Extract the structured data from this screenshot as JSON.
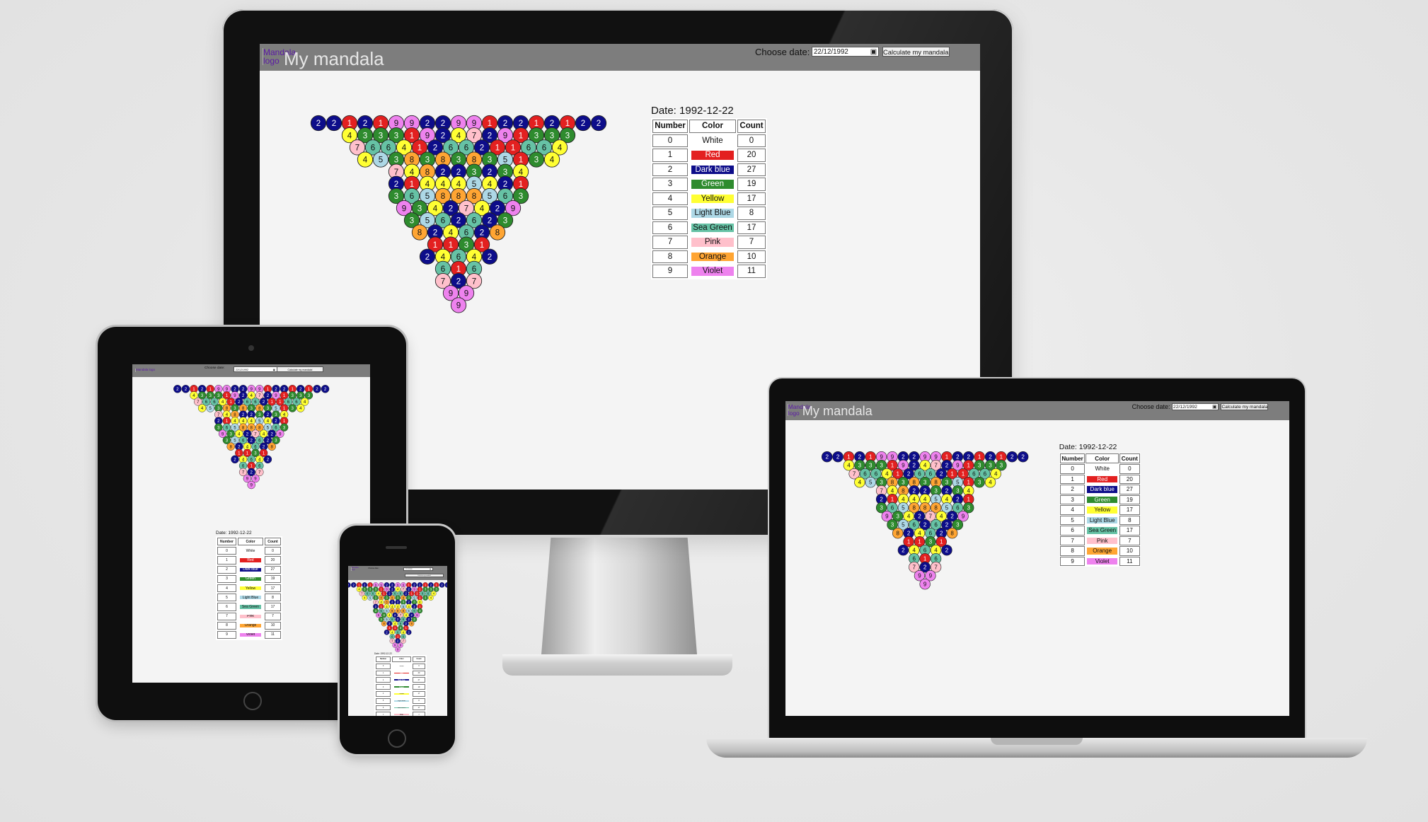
{
  "app": {
    "title": "My mandala",
    "logo_alt": "Mandala logo",
    "date_label": "Choose date:",
    "date_value": "22/12/1992",
    "calc_button": "Calculate my mandala!",
    "date_heading": "Date: 1992-12-22"
  },
  "table": {
    "headers": [
      "Number",
      "Color",
      "Count"
    ],
    "rows": [
      {
        "number": "0",
        "color": "White",
        "count": "0"
      },
      {
        "number": "1",
        "color": "Red",
        "count": "20"
      },
      {
        "number": "2",
        "color": "Dark blue",
        "count": "27"
      },
      {
        "number": "3",
        "color": "Green",
        "count": "19"
      },
      {
        "number": "4",
        "color": "Yellow",
        "count": "17"
      },
      {
        "number": "5",
        "color": "Light Blue",
        "count": "8"
      },
      {
        "number": "6",
        "color": "Sea Green",
        "count": "17"
      },
      {
        "number": "7",
        "color": "Pink",
        "count": "7"
      },
      {
        "number": "8",
        "color": "Orange",
        "count": "10"
      },
      {
        "number": "9",
        "color": "Violet",
        "count": "11"
      }
    ]
  },
  "palette": {
    "0": "#ffffff",
    "1": "#e32020",
    "2": "#0d0d8a",
    "3": "#2e8b2e",
    "4": "#ffff33",
    "5": "#add8e6",
    "6": "#66c2a5",
    "7": "#ffc0cb",
    "8": "#ffa533",
    "9": "#ee82ee"
  },
  "text_on_palette": {
    "0": "#111",
    "1": "#fff",
    "2": "#fff",
    "3": "#fff",
    "4": "#111",
    "5": "#111",
    "6": "#111",
    "7": "#111",
    "8": "#111",
    "9": "#111"
  },
  "mandala_rows": [
    "2212199229912212122",
    "433319247291333",
    "76641266211664",
    "4538383835134",
    "748223234",
    "214445421",
    "365888563",
    "93427429",
    "3562623",
    "824628",
    "1131",
    "24642",
    "616",
    "727",
    "99",
    "9"
  ],
  "header_colors": {
    "bar": "#7d7d7d",
    "screen": "#f4f4f4"
  }
}
